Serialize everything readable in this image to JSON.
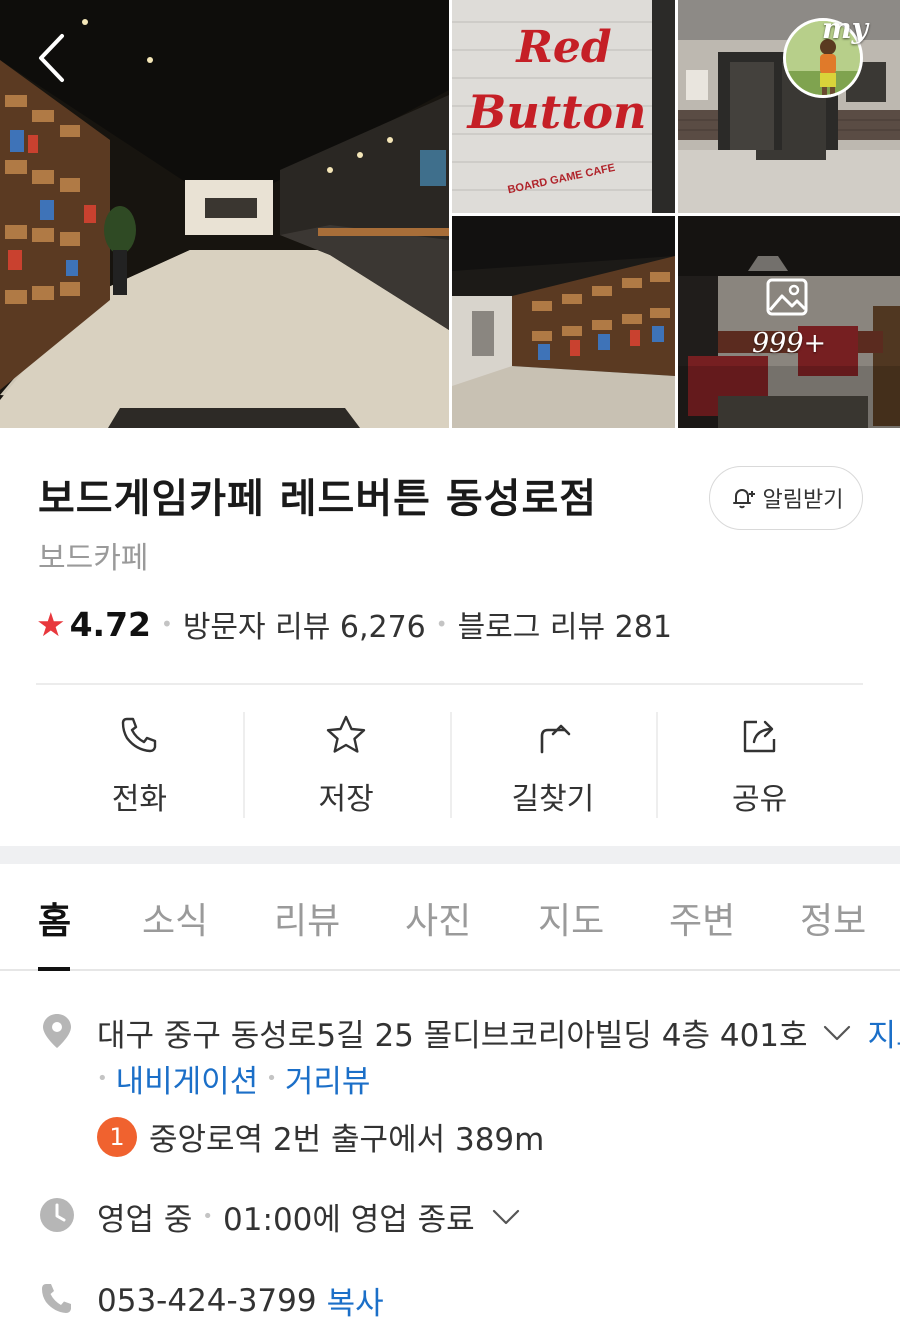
{
  "gallery": {
    "my_label": "my",
    "photo_count": "999+",
    "sign_line1": "Red",
    "sign_line2": "Button",
    "sign_sub": "BOARD GAME CAFE"
  },
  "place": {
    "title": "보드게임카페 레드버튼 동성로점",
    "category": "보드카페",
    "alarm_label": "알림받기"
  },
  "rating": {
    "score": "4.72",
    "visitor_reviews": "방문자 리뷰 6,276",
    "blog_reviews": "블로그 리뷰 281"
  },
  "actions": [
    {
      "label": "전화",
      "icon": "phone-icon"
    },
    {
      "label": "저장",
      "icon": "star-outline-icon"
    },
    {
      "label": "길찾기",
      "icon": "directions-icon"
    },
    {
      "label": "공유",
      "icon": "share-icon"
    }
  ],
  "tabs": [
    {
      "label": "홈",
      "active": true
    },
    {
      "label": "소식"
    },
    {
      "label": "리뷰"
    },
    {
      "label": "사진"
    },
    {
      "label": "지도"
    },
    {
      "label": "주변"
    },
    {
      "label": "정보"
    }
  ],
  "info": {
    "address": "대구 중구 동성로5길 25 몰디브코리아빌딩 4층 401호",
    "map_link": "지도",
    "navigation_link": "내비게이션",
    "street_view_link": "거리뷰",
    "subway_line": "1",
    "subway_text": "중앙로역 2번 출구에서 389m",
    "status": "영업 중",
    "closing": "01:00에 영업 종료",
    "phone": "053-424-3799",
    "copy_label": "복사"
  },
  "colors": {
    "accent_red": "#e8383d",
    "link_blue": "#1b6fc8",
    "subway_line1": "#f0622f"
  }
}
